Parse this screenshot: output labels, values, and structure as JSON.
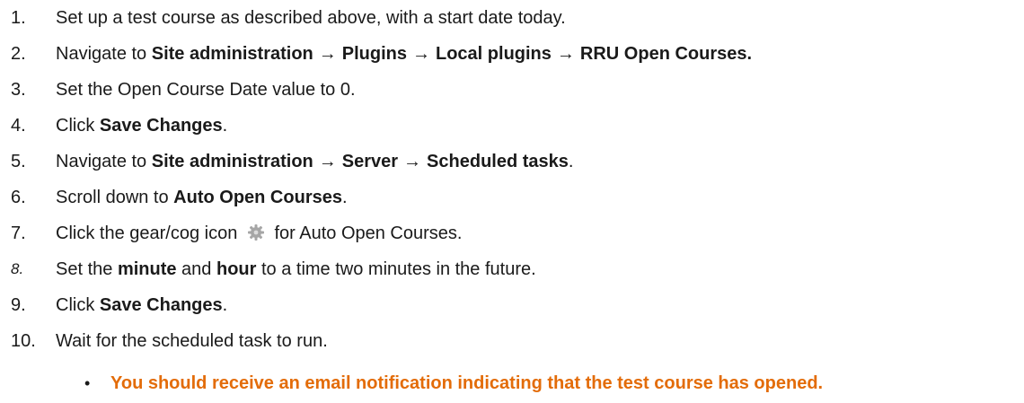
{
  "steps": [
    {
      "num": "1.",
      "text": "Set up a test course as described above, with a start date today."
    },
    {
      "num": "2.",
      "pre": "Navigate to ",
      "path": [
        "Site administration",
        "Plugins",
        "Local plugins",
        "RRU Open Courses."
      ]
    },
    {
      "num": "3.",
      "text": "Set the Open Course Date value to 0."
    },
    {
      "num": "4.",
      "pre": "Click ",
      "bold": "Save Changes",
      "post": "."
    },
    {
      "num": "5.",
      "pre": "Navigate to ",
      "path": [
        "Site administration",
        "Server",
        "Scheduled tasks"
      ],
      "post": "."
    },
    {
      "num": "6.",
      "pre": "Scroll down to ",
      "bold": "Auto Open Courses",
      "post": "."
    },
    {
      "num": "7.",
      "pre": "Click the gear/cog icon ",
      "post": " for Auto Open Courses."
    },
    {
      "num": "8.",
      "pre": "Set the ",
      "bold1": "minute",
      "mid": " and ",
      "bold2": "hour",
      "post": " to a time two minutes in the future."
    },
    {
      "num": "9.",
      "pre": "Click ",
      "bold": "Save Changes",
      "post": "."
    },
    {
      "num": "10.",
      "text": "Wait for the scheduled task to run."
    }
  ],
  "arrow": "→",
  "bullet": {
    "symbol": "•",
    "text": "You should receive an email notification indicating that the test course has opened.",
    "color": "#e36c09"
  },
  "icons": {
    "gear": "gear-icon"
  }
}
